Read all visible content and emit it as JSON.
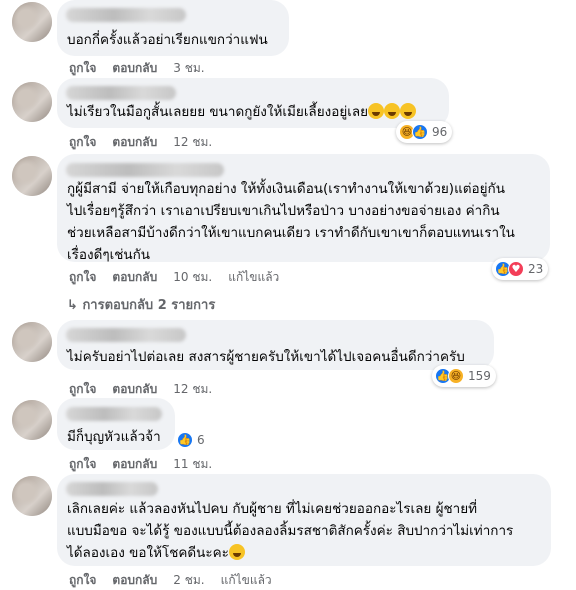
{
  "labels": {
    "like": "ถูกใจ",
    "reply": "ตอบกลับ",
    "edited": "แก้ไขแล้ว"
  },
  "comments": [
    {
      "text": [
        "บอกกี่ครั้งแล้วอย่าเรียกแขกว่าแฟน"
      ],
      "time": "3 ชม."
    },
    {
      "text": [
        "ไม่เรียวในมือกูสั้นเลยยย ขนาดกูยังให้เมียเลี้ยงอยู่เลย"
      ],
      "time": "12 ชม.",
      "reaction_count": "96"
    },
    {
      "text": [
        "กูผู้มีสามี จ่ายให้เกือบทุกอย่าง ให้ทั้งเงินเดือน(เราทำงานให้เขาด้วย)แต่อยู่กัน",
        "ไปเรื่อยๆรู้สึกว่า เราเอาเปรียบเขาเกินไปหรือป่าว บางอย่างขอจ่ายเอง ค่ากิน",
        "ช่วยเหลือสามีบ้างดีกว่าให้เขาแบกคนเดียว เราทำดีกับเขาเขาก็ตอบแทนเราใน",
        "เรื่องดีๆเช่นกัน"
      ],
      "time": "10 ชม.",
      "edited": true,
      "reaction_count": "23",
      "replies": "การตอบกลับ 2 รายการ"
    },
    {
      "text": [
        "ไม่ครับอย่าไปต่อเลย สงสารผู้ชายครับให้เขาได้ไปเจอคนอื่นดีกว่าครับ"
      ],
      "time": "12 ชม.",
      "reaction_count": "159"
    },
    {
      "text": [
        "มีก็บุญหัวแล้วจ้า"
      ],
      "time": "11 ชม.",
      "reaction_count": "6"
    },
    {
      "text": [
        "เลิกเลยค่ะ แล้วลองหันไปคบ กับผู้ชาย ที่ไม่เคยช่วยออกอะไรเลย ผู้ชายที่",
        "แบบมือขอ จะได้รู้ ของแบบนี้ต้องลองลิ้มรสชาติสักครั้งค่ะ สิบปากว่าไม่เท่าการ",
        "ได้ลองเอง ขอให้โชคดีนะคะ"
      ],
      "time": "2 ชม.",
      "edited": true
    }
  ]
}
